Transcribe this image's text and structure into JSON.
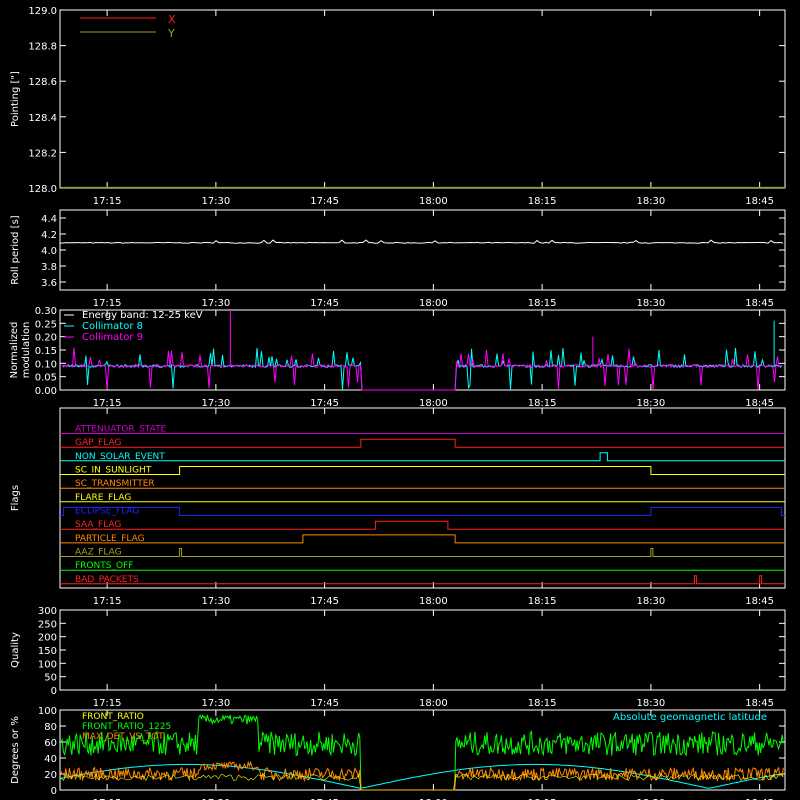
{
  "time_ticks": [
    "17:15",
    "17:30",
    "17:45",
    "18:00",
    "18:15",
    "18:30",
    "18:45"
  ],
  "chart_data": [
    {
      "id": "pointing",
      "type": "line",
      "ylabel": "Pointing [\"]",
      "ylim": [
        128.0,
        129.0
      ],
      "yticks": [
        "128.0",
        "128.2",
        "128.4",
        "128.6",
        "128.8",
        "129.0"
      ],
      "legend": [
        {
          "name": "X",
          "color": "#ff2020"
        },
        {
          "name": "Y",
          "color": "#a0a020"
        }
      ],
      "series": [
        {
          "name": "Y",
          "color": "#a0a020",
          "value": 128.0
        }
      ]
    },
    {
      "id": "roll",
      "type": "line",
      "ylabel": "Roll period [s]",
      "ylim": [
        3.5,
        4.5
      ],
      "yticks": [
        "3.6",
        "3.8",
        "4.0",
        "4.2",
        "4.4"
      ],
      "series": [
        {
          "name": "roll period",
          "color": "#ffffff",
          "base": 4.09
        }
      ]
    },
    {
      "id": "modulation",
      "type": "line",
      "ylabel": "Normalized modulation",
      "ylim": [
        0,
        0.3
      ],
      "yticks": [
        "0.00",
        "0.05",
        "0.10",
        "0.15",
        "0.20",
        "0.25",
        "0.30"
      ],
      "legend": [
        {
          "name": "Energy band: 12-25 keV",
          "color": "#ffffff"
        },
        {
          "name": "Collimator 8",
          "color": "#00ffff"
        },
        {
          "name": "Collimator 9",
          "color": "#ff00ff"
        }
      ],
      "gap": [
        "17:50",
        "18:03"
      ]
    },
    {
      "id": "flags",
      "type": "line",
      "ylabel": "Flags",
      "flags": [
        {
          "name": "ATTENUATOR_STATE",
          "color": "#cc00cc",
          "on": []
        },
        {
          "name": "GAP_FLAG",
          "color": "#ff2020",
          "on": [
            [
              "17:50",
              "18:03"
            ]
          ]
        },
        {
          "name": "NON_SOLAR_EVENT",
          "color": "#00ffff",
          "on": [
            [
              "18:23",
              "18:24"
            ]
          ]
        },
        {
          "name": "SC_IN_SUNLIGHT",
          "color": "#ffff00",
          "on": [
            [
              "17:25",
              "18:30"
            ]
          ]
        },
        {
          "name": "SC_TRANSMITTER",
          "color": "#ff8800",
          "on": []
        },
        {
          "name": "FLARE_FLAG",
          "color": "#ffff00",
          "on": []
        },
        {
          "name": "ECLIPSE_FLAG",
          "color": "#2020ff",
          "on": [
            [
              "17:09",
              "17:25"
            ],
            [
              "18:30",
              "18:48"
            ]
          ]
        },
        {
          "name": "SAA_FLAG",
          "color": "#ff2020",
          "on": [
            [
              "17:52",
              "18:02"
            ]
          ]
        },
        {
          "name": "PARTICLE_FLAG",
          "color": "#ff8800",
          "on": [
            [
              "17:42",
              "18:03"
            ]
          ]
        },
        {
          "name": "AAZ_FLAG",
          "color": "#a0a020",
          "on": [
            [
              "17:25",
              "17:25"
            ],
            [
              "18:30",
              "18:30"
            ]
          ]
        },
        {
          "name": "FRONTS_OFF",
          "color": "#00ff00",
          "on": []
        },
        {
          "name": "BAD_PACKETS",
          "color": "#ff2020",
          "on": [
            [
              "18:36",
              "18:36"
            ],
            [
              "18:45",
              "18:45"
            ]
          ]
        }
      ]
    },
    {
      "id": "quality",
      "type": "line",
      "ylabel": "Quality",
      "ylim": [
        0,
        300
      ],
      "yticks": [
        "0",
        "50",
        "100",
        "150",
        "200",
        "250",
        "300"
      ],
      "series": []
    },
    {
      "id": "ratios",
      "type": "line",
      "ylabel": "Degrees or %",
      "ylim": [
        0,
        100
      ],
      "yticks": [
        "0",
        "20",
        "40",
        "60",
        "80",
        "100"
      ],
      "legend": [
        {
          "name": "FRONT_RATIO",
          "color": "#ffff00"
        },
        {
          "name": "FRONT_RATIO_1225",
          "color": "#00ff00"
        },
        {
          "name": "MAX_DET_VS_TOT",
          "color": "#ff8800"
        }
      ],
      "annotation": {
        "text": "Absolute geomagnetic latitude",
        "color": "#00ffff"
      }
    }
  ]
}
